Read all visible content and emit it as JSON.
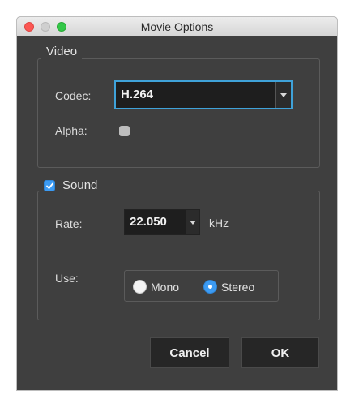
{
  "window": {
    "title": "Movie Options"
  },
  "video": {
    "group_label": "Video",
    "codec_label": "Codec:",
    "codec_value": "H.264",
    "alpha_label": "Alpha:",
    "alpha_checked": false
  },
  "sound": {
    "group_label": "Sound",
    "enabled": true,
    "rate_label": "Rate:",
    "rate_value": "22.050",
    "rate_unit": "kHz",
    "use_label": "Use:",
    "options": [
      {
        "label": "Mono",
        "selected": false
      },
      {
        "label": "Stereo",
        "selected": true
      }
    ]
  },
  "buttons": {
    "cancel": "Cancel",
    "ok": "OK"
  },
  "colors": {
    "dialog_bg": "#3f3f3f",
    "accent": "#3c9bf3",
    "focus_ring": "#3fa2d9"
  }
}
